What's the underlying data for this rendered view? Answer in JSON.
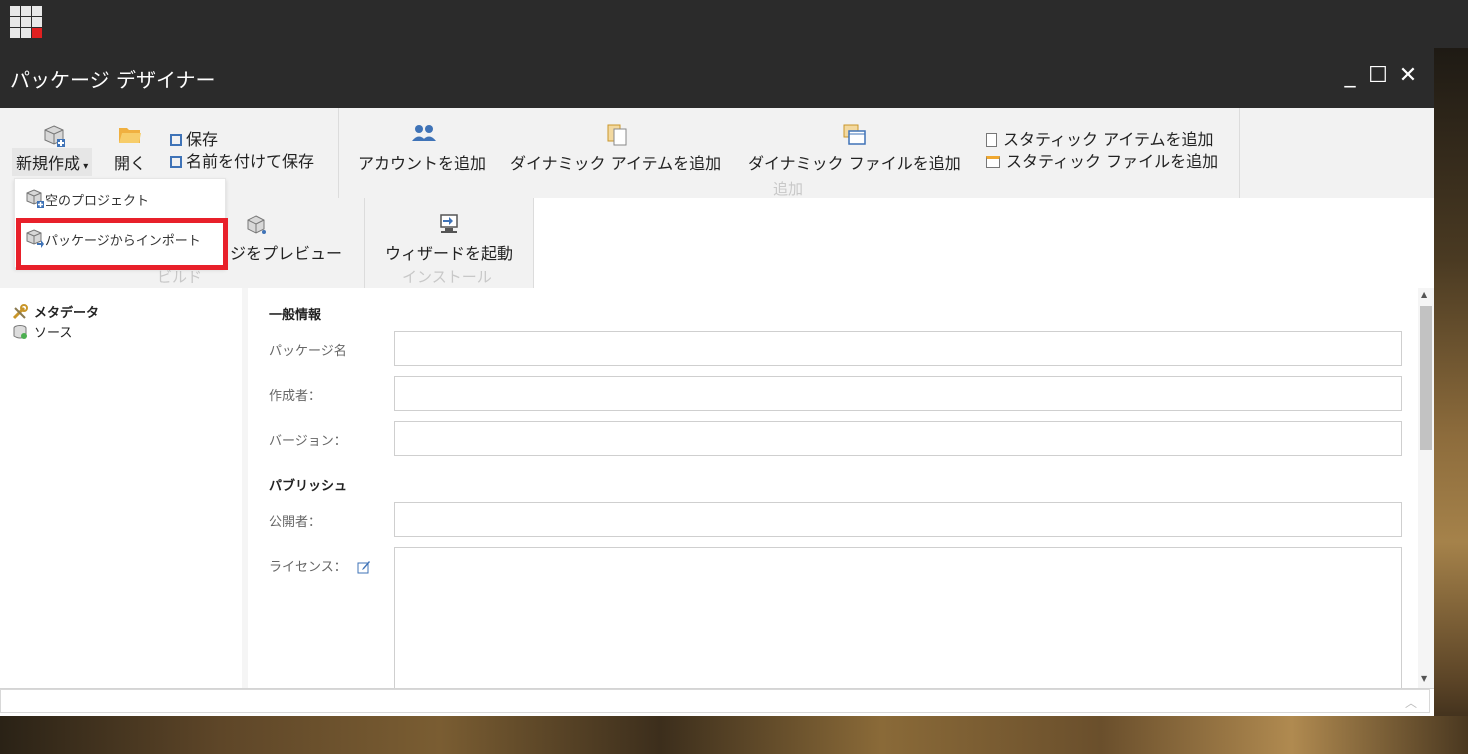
{
  "window": {
    "title": "パッケージ デザイナー",
    "controls": {
      "minimize": "_",
      "maximize": "☐",
      "close": "✕"
    }
  },
  "ribbon": {
    "new": "新規作成",
    "open": "開く",
    "save": "保存",
    "save_as": "名前を付けて保存",
    "add_account": "アカウントを追加",
    "add_dynamic_item": "ダイナミック アイテムを追加",
    "add_dynamic_file": "ダイナミック ファイルを追加",
    "add_static_item": "スタティック アイテムを追加",
    "add_static_file": "スタティック ファイルを追加",
    "group_add": "追加",
    "preview_package": "ジをプレビュー",
    "group_build": "ビルド",
    "start_wizard": "ウィザードを起動",
    "group_install": "インストール"
  },
  "new_dropdown": {
    "items": [
      {
        "label": "空のプロジェクト"
      },
      {
        "label": "パッケージからインポート"
      }
    ]
  },
  "tree": {
    "items": [
      {
        "label": "メタデータ"
      },
      {
        "label": "ソース"
      }
    ]
  },
  "form": {
    "general_info": "一般情報",
    "package_name_label": "パッケージ名",
    "author_label": "作成者：",
    "version_label": "バージョン：",
    "publish_section": "パブリッシュ",
    "publisher_label": "公開者：",
    "license_label": "ライセンス：",
    "package_name_value": "",
    "author_value": "",
    "version_value": "",
    "publisher_value": "",
    "license_value": ""
  },
  "colors": {
    "titlebar": "#2b2b2b",
    "ribbon": "#f2f2f2",
    "highlight": "#e8202a",
    "icon_blue": "#3f73b7",
    "icon_orange": "#f0a830"
  }
}
